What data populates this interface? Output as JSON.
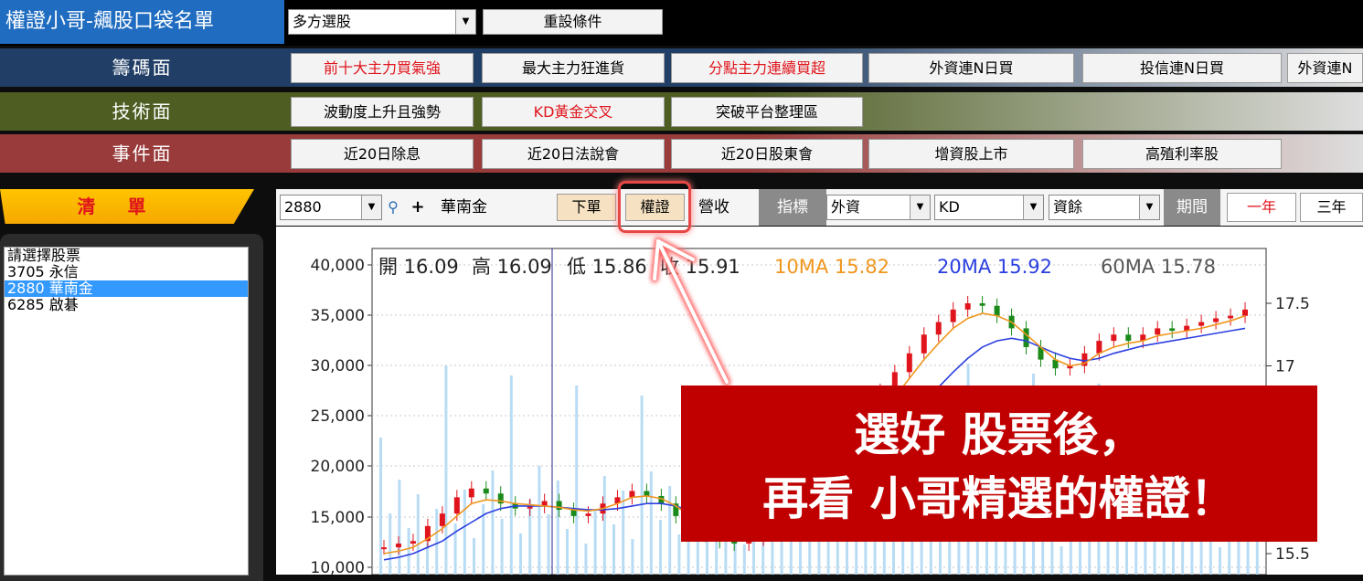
{
  "app": {
    "title": "權證小哥-飆股口袋名單"
  },
  "top": {
    "strategy_select": "多方選股",
    "reset_button": "重設條件"
  },
  "categories": [
    {
      "label": "籌碼面",
      "color": "#213f66",
      "buttons": [
        {
          "label": "前十大主力買氣強",
          "red": true
        },
        {
          "label": "最大主力狂進貨",
          "red": false
        },
        {
          "label": "分點主力連續買超",
          "red": true
        },
        {
          "label": "外資連N日買",
          "red": false
        },
        {
          "label": "投信連N日買",
          "red": false
        },
        {
          "label": "外資連N",
          "red": false
        }
      ]
    },
    {
      "label": "技術面",
      "color": "#4e5e23",
      "buttons": [
        {
          "label": "波動度上升且強勢",
          "red": false
        },
        {
          "label": "KD黃金交叉",
          "red": true
        },
        {
          "label": "突破平台整理區",
          "red": false
        }
      ]
    },
    {
      "label": "事件面",
      "color": "#9a3b3b",
      "buttons": [
        {
          "label": "近20日除息",
          "red": false
        },
        {
          "label": "近20日法說會",
          "red": false
        },
        {
          "label": "近20日股東會",
          "red": false
        },
        {
          "label": "增資股上市",
          "red": false
        },
        {
          "label": "高殖利率股",
          "red": false
        }
      ]
    }
  ],
  "list": {
    "header": "清 單",
    "items": [
      "請選擇股票",
      "3705 永信",
      "2880 華南金",
      "6285 啟碁"
    ],
    "selected_index": 2
  },
  "toolbar": {
    "code_value": "2880",
    "stock_name": "華南金",
    "order_button": "下單",
    "warrant_button": "權證",
    "revenue_button": "營收",
    "indicator_label": "指標",
    "select1": "外資",
    "select2": "KD",
    "select3": "資餘",
    "period_label": "期間",
    "one_year": "一年",
    "three_year": "三年"
  },
  "chart_data": {
    "type": "line",
    "info_open": "開 16.09",
    "info_high": "高 16.09",
    "info_low": "低 15.86",
    "info_close": "收 15.91",
    "ma10": "10MA 15.82",
    "ma20": "20MA 15.92",
    "ma60": "60MA 15.78",
    "left_ticks": [
      "40,000",
      "35,000",
      "30,000",
      "25,000",
      "20,000",
      "15,000",
      "10,000"
    ],
    "right_ticks": [
      "17.5",
      "17",
      "15.5"
    ],
    "price_series": [
      15.55,
      15.58,
      15.6,
      15.72,
      15.82,
      15.95,
      16.02,
      15.98,
      15.9,
      15.86,
      15.88,
      15.92,
      15.85,
      15.8,
      15.82,
      15.9,
      15.95,
      16.0,
      15.96,
      15.9,
      15.8,
      15.72,
      15.65,
      15.6,
      15.58,
      15.62,
      15.7,
      15.82,
      15.98,
      16.1,
      16.2,
      16.35,
      16.5,
      16.65,
      16.8,
      16.95,
      17.1,
      17.25,
      17.35,
      17.45,
      17.5,
      17.48,
      17.4,
      17.3,
      17.15,
      17.05,
      16.98,
      17.0,
      17.1,
      17.2,
      17.25,
      17.2,
      17.25,
      17.3,
      17.28,
      17.32,
      17.35,
      17.38,
      17.4,
      17.45
    ],
    "ma10_series": [
      15.5,
      15.52,
      15.55,
      15.62,
      15.7,
      15.8,
      15.9,
      15.93,
      15.92,
      15.9,
      15.89,
      15.88,
      15.87,
      15.85,
      15.84,
      15.86,
      15.9,
      15.95,
      15.96,
      15.94,
      15.88,
      15.8,
      15.72,
      15.66,
      15.62,
      15.6,
      15.62,
      15.68,
      15.78,
      15.9,
      16.02,
      16.15,
      16.3,
      16.45,
      16.6,
      16.75,
      16.9,
      17.05,
      17.18,
      17.3,
      17.38,
      17.42,
      17.4,
      17.35,
      17.25,
      17.15,
      17.05,
      17.0,
      17.02,
      17.1,
      17.15,
      17.18,
      17.2,
      17.24,
      17.26,
      17.28,
      17.3,
      17.33,
      17.36,
      17.4
    ],
    "ma20_series": [
      15.45,
      15.47,
      15.5,
      15.55,
      15.6,
      15.68,
      15.75,
      15.82,
      15.86,
      15.88,
      15.88,
      15.88,
      15.87,
      15.86,
      15.85,
      15.85,
      15.86,
      15.88,
      15.9,
      15.9,
      15.88,
      15.84,
      15.78,
      15.72,
      15.68,
      15.64,
      15.63,
      15.64,
      15.68,
      15.75,
      15.84,
      15.94,
      16.05,
      16.17,
      16.3,
      16.43,
      16.57,
      16.7,
      16.83,
      16.95,
      17.06,
      17.15,
      17.2,
      17.22,
      17.2,
      17.15,
      17.1,
      17.06,
      17.04,
      17.06,
      17.1,
      17.13,
      17.16,
      17.18,
      17.2,
      17.22,
      17.24,
      17.26,
      17.28,
      17.3
    ]
  },
  "callout": {
    "line1": "選好 股票後，",
    "line2": "再看 小哥精選的權證！"
  }
}
